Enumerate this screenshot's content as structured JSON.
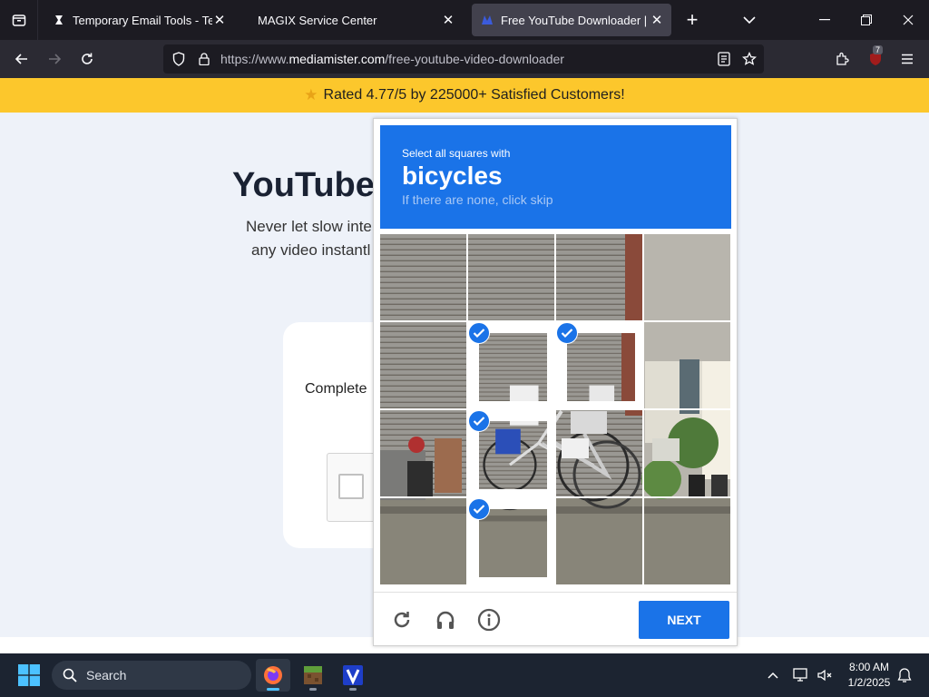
{
  "browser": {
    "tabs": [
      {
        "title": "Temporary Email Tools - Tempo",
        "active": false
      },
      {
        "title": "MAGIX Service Center",
        "active": false
      },
      {
        "title": "Free YouTube Downloader | Do",
        "active": true
      }
    ],
    "url_prefix": "https://www.",
    "url_domain": "mediamister.com",
    "url_path": "/free-youtube-video-downloader",
    "extension_badge": "7"
  },
  "page": {
    "banner_text": "Rated 4.77/5 by 225000+ Satisfied Customers!",
    "hero_title": "YouTube",
    "hero_sub_line1": "Never let slow inte",
    "hero_sub_line2": "any video instantl",
    "complete_text": "Complete"
  },
  "captcha": {
    "instruction": "Select all squares with",
    "target": "bicycles",
    "hint": "If there are none, click skip",
    "next_label": "NEXT",
    "selected_tiles": [
      5,
      6,
      9,
      13
    ],
    "accent_color": "#1a73e8"
  },
  "taskbar": {
    "search_label": "Search",
    "time": "8:00 AM",
    "date": "1/2/2025"
  }
}
